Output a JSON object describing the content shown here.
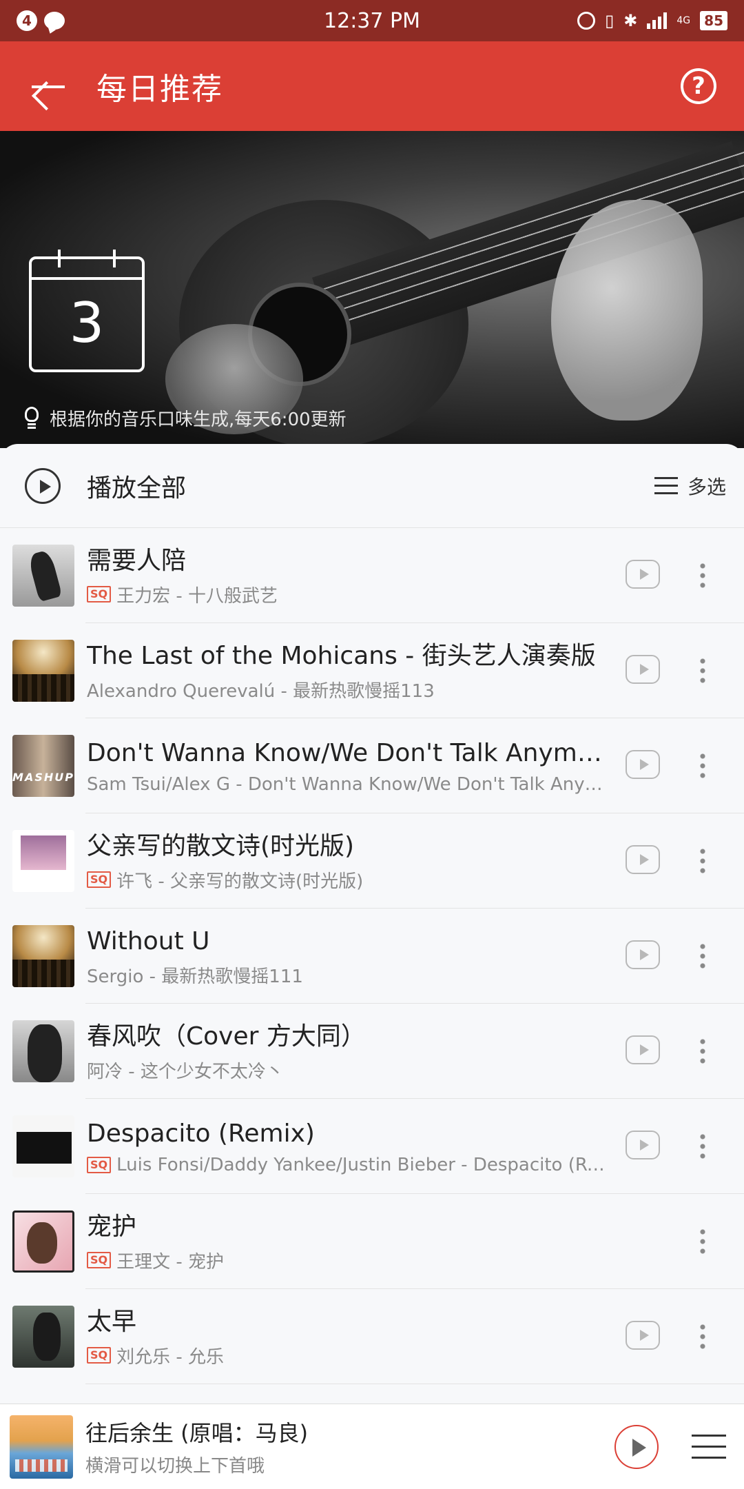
{
  "status_bar": {
    "notification_count": "4",
    "time": "12:37 PM",
    "network": "4G",
    "battery": "85"
  },
  "app_bar": {
    "title": "每日推荐",
    "back_icon": "arrow-left",
    "help_icon": "question-circle"
  },
  "hero": {
    "day": "3",
    "note": "根据你的音乐口味生成,每天6:00更新"
  },
  "list_header": {
    "play_all": "播放全部",
    "multi_select": "多选"
  },
  "songs": [
    {
      "title": "需要人陪",
      "sq": "SQ",
      "subtitle": "王力宏 - 十八般武艺",
      "has_play": true
    },
    {
      "title": "The Last of the Mohicans - 街头艺人演奏版",
      "sq": "",
      "subtitle": "Alexandro Querevalú - 最新热歌慢摇113",
      "has_play": true
    },
    {
      "title": "Don't Wanna Know/We Don't Talk Anymore",
      "sq": "",
      "subtitle": "Sam Tsui/Alex G - Don't Wanna Know/We Don't Talk Anym…",
      "has_play": true
    },
    {
      "title": "父亲写的散文诗(时光版)",
      "sq": "SQ",
      "subtitle": "许飞 - 父亲写的散文诗(时光版)",
      "has_play": true
    },
    {
      "title": "Without U",
      "sq": "",
      "subtitle": "Sergio - 最新热歌慢摇111",
      "has_play": true
    },
    {
      "title": "春风吹（Cover 方大同）",
      "sq": "",
      "subtitle": "阿冷 - 这个少女不太冷丶",
      "has_play": true
    },
    {
      "title": "Despacito (Remix)",
      "sq": "SQ",
      "subtitle": "Luis Fonsi/Daddy Yankee/Justin Bieber - Despacito (Re…",
      "has_play": true
    },
    {
      "title": "宠护",
      "sq": "SQ",
      "subtitle": "王理文 - 宠护",
      "has_play": false
    },
    {
      "title": "太早",
      "sq": "SQ",
      "subtitle": "刘允乐 - 允乐",
      "has_play": true
    }
  ],
  "mini_player": {
    "title": "往后余生 (原唱：马良)",
    "subtitle": "横滑可以切换上下首哦"
  },
  "colors": {
    "status_bar": "#8c2b24",
    "app_bar": "#db3f35",
    "sq_badge": "#e35a44"
  }
}
